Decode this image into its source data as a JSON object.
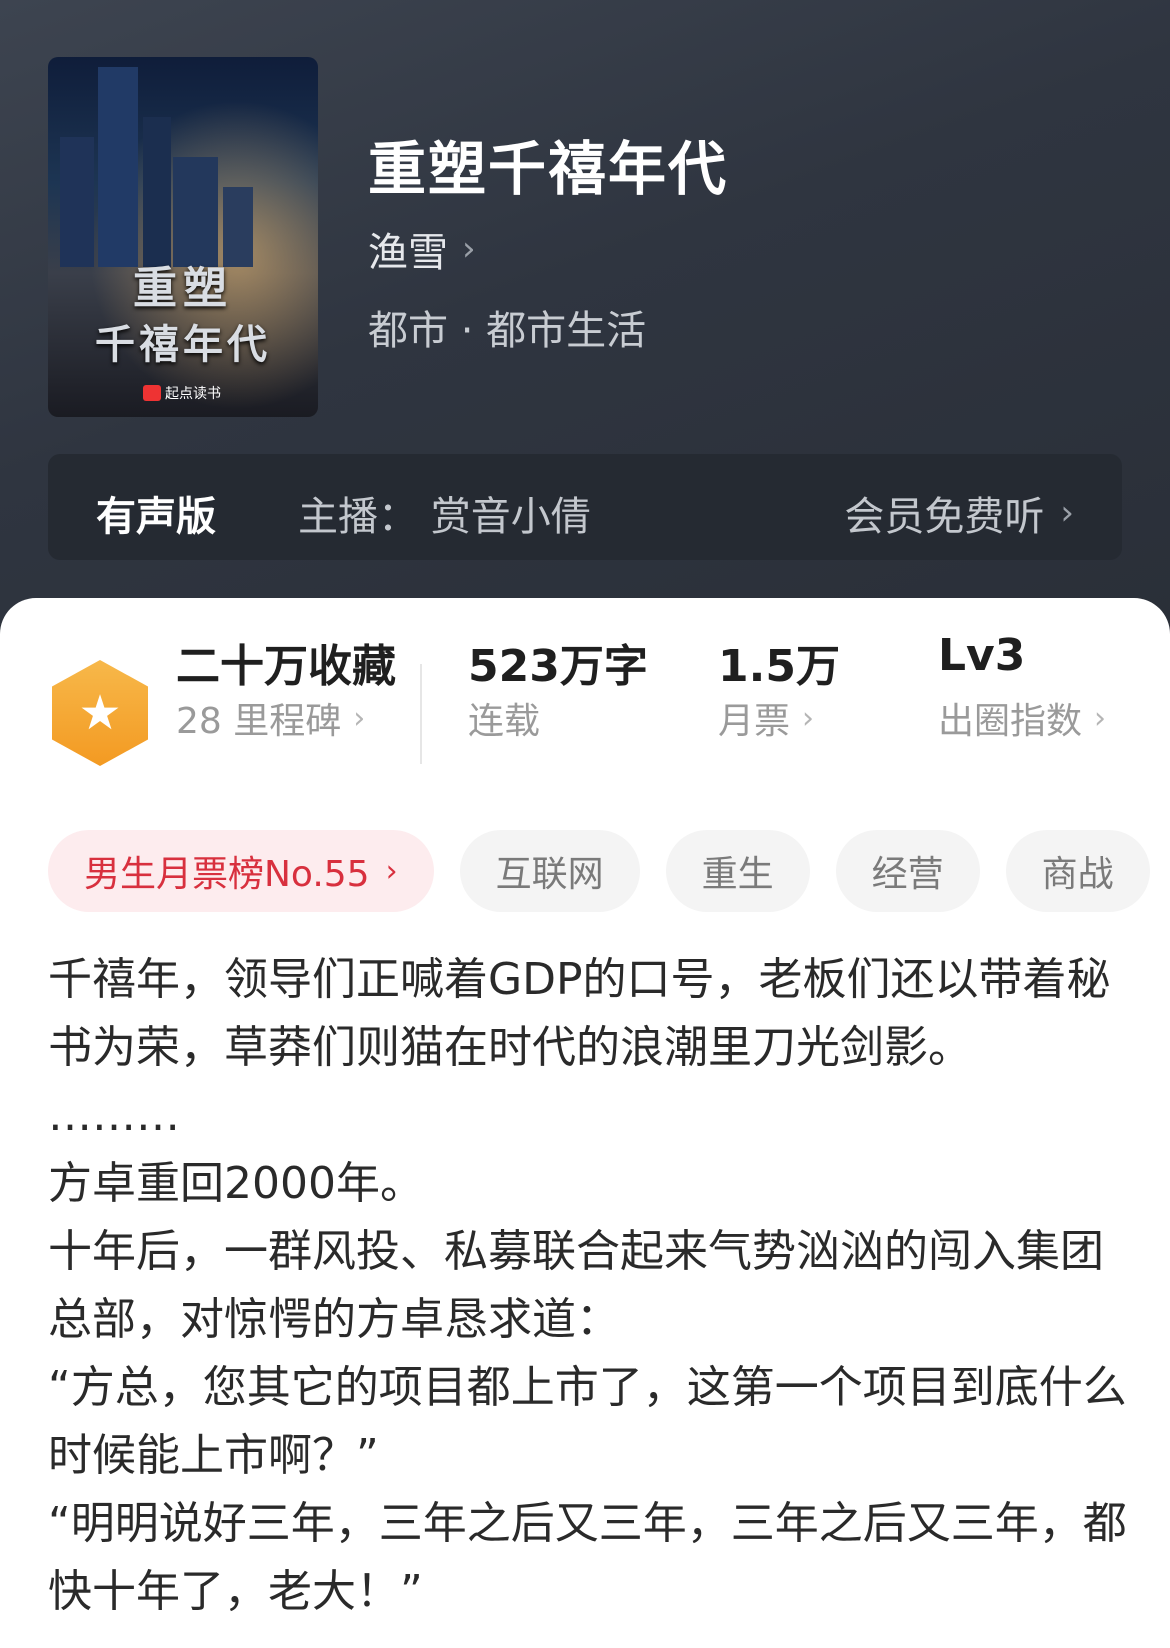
{
  "header": {
    "cover_title_line1": "重塑",
    "cover_title_line2": "千禧年代",
    "cover_publisher": "起点读书",
    "title": "重塑千禧年代",
    "author": "渔雪",
    "genre": "都市 · 都市生活"
  },
  "audio": {
    "label": "有声版",
    "narrator": "主播：  赏音小倩",
    "cta": "会员免费听"
  },
  "stats": {
    "collect": {
      "main": "二十万收藏",
      "sub": "28 里程碑"
    },
    "words": {
      "main": "523万字",
      "sub": "连载"
    },
    "votes": {
      "main": "1.5万",
      "sub": "月票"
    },
    "level": {
      "main": "Lv3",
      "sub": "出圈指数"
    }
  },
  "tags": {
    "rank": "男生月票榜No.55",
    "items": [
      "互联网",
      "重生",
      "经营",
      "商战"
    ]
  },
  "synopsis": [
    "千禧年，领导们正喊着GDP的口号，老板们还以带着秘书为荣，草莽们则猫在时代的浪潮里刀光剑影。",
    "………",
    "方卓重回2000年。",
    "十年后，一群风投、私募联合起来气势汹汹的闯入集团总部，对惊愕的方卓恳求道：",
    "“方总，您其它的项目都上市了，这第一个项目到底什么时候能上市啊？”",
    "“明明说好三年，三年之后又三年，三年之后又三年，都快十年了，老大！”"
  ],
  "colors": {
    "header_bg": "#2f3540",
    "accent_red": "#d8303e",
    "badge_orange": "#f39a22"
  }
}
